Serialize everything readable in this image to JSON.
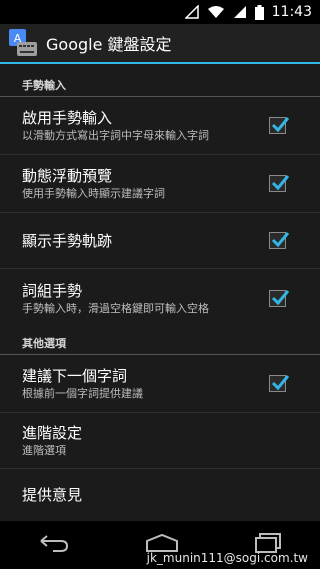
{
  "status_bar": {
    "time": "11:43"
  },
  "action_bar": {
    "title": "Google 鍵盤設定"
  },
  "sections": [
    {
      "header": "手勢輸入"
    },
    {
      "header": "其他選項"
    }
  ],
  "items": [
    {
      "title": "啟用手勢輸入",
      "summary": "以滑動方式寫出字詞中字母來輸入字詞",
      "checked": true
    },
    {
      "title": "動態浮動預覽",
      "summary": "使用手勢輸入時顯示建議字詞",
      "checked": true
    },
    {
      "title": "顯示手勢軌跡",
      "summary": "",
      "checked": true
    },
    {
      "title": "詞組手勢",
      "summary": "手勢輸入時，滑過空格鍵即可輸入空格",
      "checked": true
    },
    {
      "title": "建議下一個字詞",
      "summary": "根據前一個字詞提供建議",
      "checked": true
    },
    {
      "title": "進階設定",
      "summary": "進階選項"
    },
    {
      "title": "提供意見",
      "summary": ""
    }
  ],
  "watermark": "jk_munin111@sogi.com.tw",
  "colors": {
    "accent": "#33b5e5",
    "background": "#1b1b1b"
  },
  "icons": [
    "signal-icon",
    "wifi-icon",
    "battery-icon",
    "keyboard-app-icon",
    "back-icon",
    "home-icon",
    "recents-icon"
  ]
}
